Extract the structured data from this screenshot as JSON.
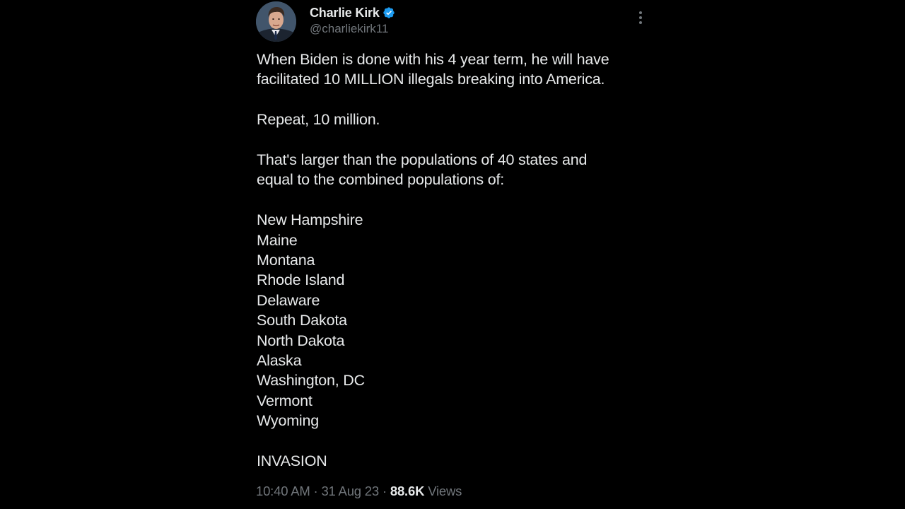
{
  "author": {
    "display_name": "Charlie Kirk",
    "handle": "@charliekirk11",
    "verified": true,
    "verified_color": "#1d9bf0",
    "avatar_icon": "profile-photo"
  },
  "menu": {
    "icon": "more-vertical-icon"
  },
  "tweet": {
    "line1": "When Biden is done with his 4 year term, he will have",
    "line2": "facilitated 10 MILLION illegals breaking into America.",
    "repeat": "Repeat, 10 million.",
    "larger_line1": "That's larger than the populations of 40 states and",
    "larger_line2": "equal to the combined populations of:",
    "states": [
      "New Hampshire",
      "Maine",
      "Montana",
      "Rhode Island",
      "Delaware",
      "South Dakota",
      "North Dakota",
      "Alaska",
      "Washington, DC",
      "Vermont",
      "Wyoming"
    ],
    "closing": "INVASION"
  },
  "meta": {
    "time": "10:40 AM",
    "separator": "·",
    "date": "31 Aug 23",
    "views_count": "88.6K",
    "views_label": "Views"
  },
  "colors": {
    "background": "#000000",
    "text_primary": "#e7e9ea",
    "text_secondary": "#71767b"
  }
}
